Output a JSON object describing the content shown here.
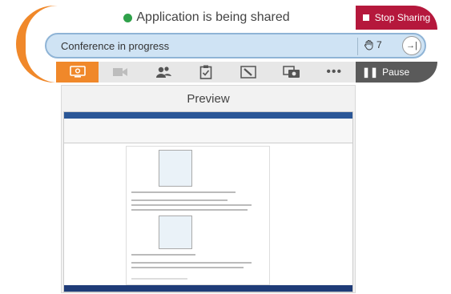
{
  "share": {
    "status": "Application is being shared",
    "stop_label": "Stop Sharing"
  },
  "conference": {
    "text": "Conference in progress",
    "hand_count": "7"
  },
  "toolbar": {
    "pause_label": "Pause"
  },
  "preview": {
    "title": "Preview"
  },
  "colors": {
    "accent": "#f0882a",
    "stop": "#b5183c",
    "pause": "#5a5a5a",
    "status_dot": "#2fa14a"
  }
}
